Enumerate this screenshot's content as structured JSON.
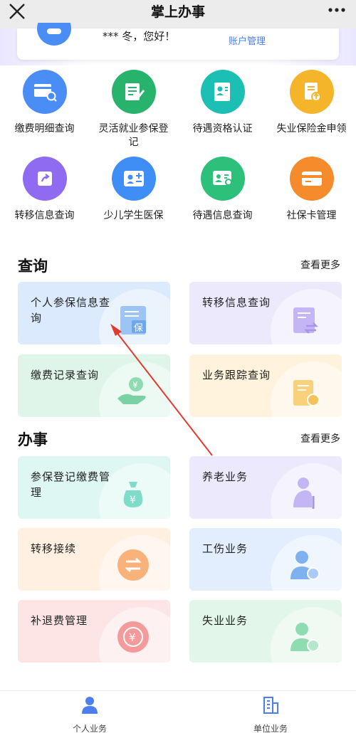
{
  "topbar": {
    "title": "掌上办事"
  },
  "greeting": {
    "text": "，您好！",
    "prefix": "*** 冬",
    "account": "账户管理"
  },
  "grid": [
    {
      "label": "缴费明细查询",
      "color": "#4a8ef5",
      "icon": "card-search-icon"
    },
    {
      "label": "灵活就业参保登记",
      "color": "#28b36d",
      "icon": "form-edit-icon"
    },
    {
      "label": "待遇资格认证",
      "color": "#1cbfb3",
      "icon": "id-verify-icon"
    },
    {
      "label": "失业保险金申领",
      "color": "#f5b52a",
      "icon": "doc-upload-icon"
    },
    {
      "label": "转移信息查询",
      "color": "#8e6bf0",
      "icon": "transfer-share-icon"
    },
    {
      "label": "少儿学生医保",
      "color": "#3f8ef5",
      "icon": "student-card-icon"
    },
    {
      "label": "待遇信息查询",
      "color": "#2cc07a",
      "icon": "id-search-icon"
    },
    {
      "label": "社保卡管理",
      "color": "#f58b2a",
      "icon": "social-card-icon"
    }
  ],
  "query": {
    "title": "查询",
    "more": "查看更多",
    "cards": [
      {
        "label": "个人参保信息查询",
        "bg": "#dbeafc",
        "icon": "insurance-doc-icon"
      },
      {
        "label": "转移信息查询",
        "bg": "#ece9fd",
        "icon": "transfer-doc-icon"
      },
      {
        "label": "缴费记录查询",
        "bg": "#dff5ea",
        "icon": "payment-hand-icon"
      },
      {
        "label": "业务跟踪查询",
        "bg": "#fff3dd",
        "icon": "tracking-doc-icon"
      }
    ]
  },
  "affairs": {
    "title": "办事",
    "more": "查看更多",
    "cards": [
      {
        "label": "参保登记缴费管理",
        "bg": "#def7f2",
        "icon": "money-bag-icon"
      },
      {
        "label": "养老业务",
        "bg": "#ece9fd",
        "icon": "elderly-icon"
      },
      {
        "label": "转移接续",
        "bg": "#fff0e2",
        "icon": "transfer-circle-icon"
      },
      {
        "label": "工伤业务",
        "bg": "#e2eefd",
        "icon": "injury-user-icon"
      },
      {
        "label": "补退费管理",
        "bg": "#fde5e5",
        "icon": "refund-icon"
      },
      {
        "label": "失业业务",
        "bg": "#e3f6ea",
        "icon": "unemployed-user-icon"
      }
    ]
  },
  "tabbar": [
    {
      "label": "个人业务",
      "active": true
    },
    {
      "label": "单位业务",
      "active": false
    }
  ],
  "colors": {
    "accent": "#4d7ef0",
    "arrow": "#e23b2e"
  }
}
